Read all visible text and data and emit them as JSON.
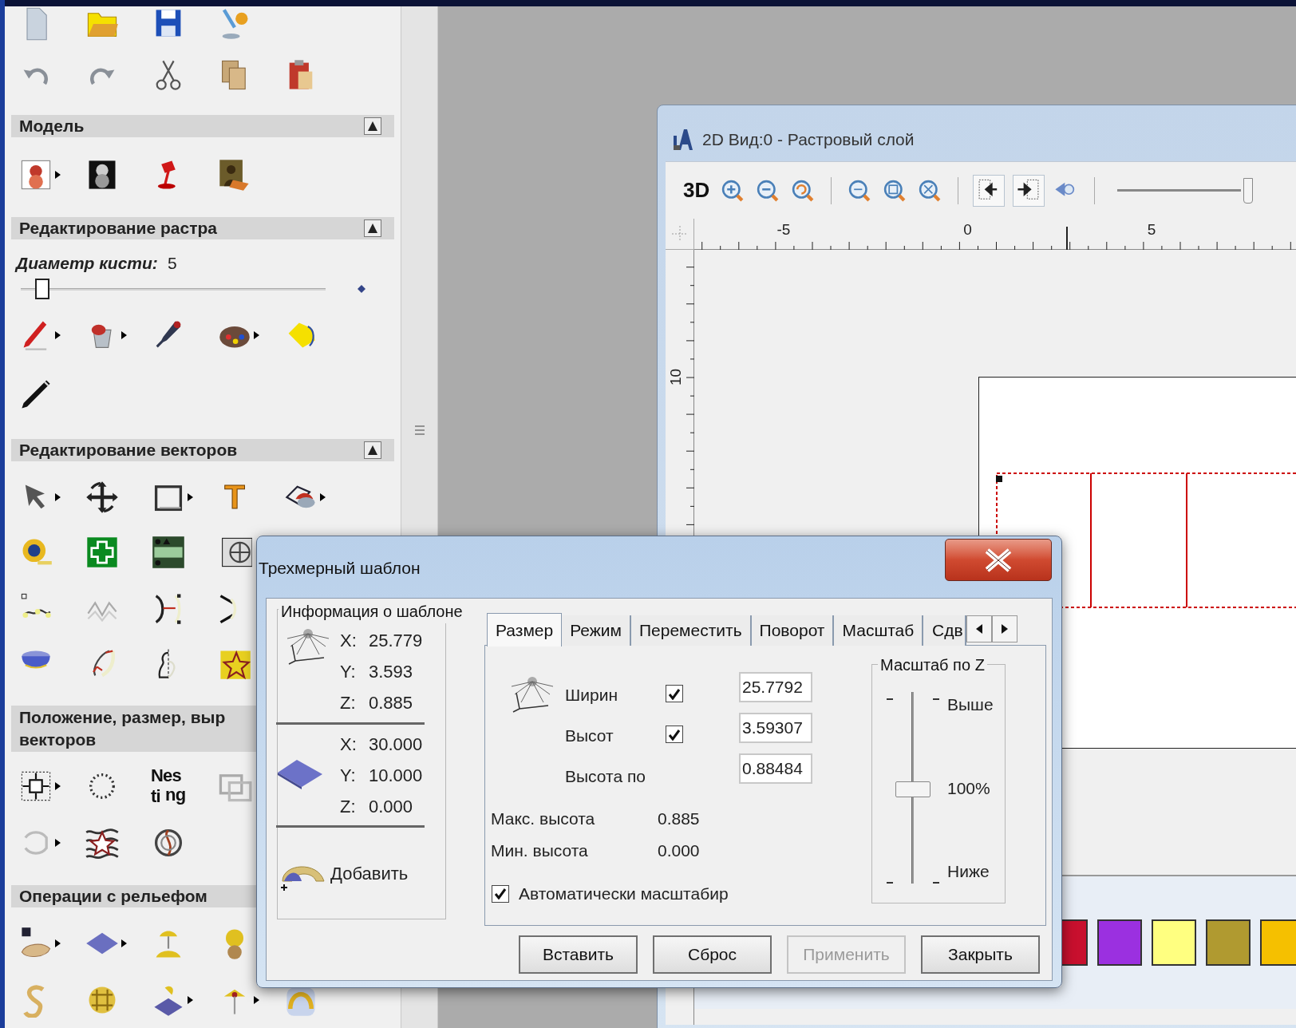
{
  "left_panel": {
    "sections": [
      {
        "title_lines": [
          "Модель"
        ]
      },
      {
        "title_lines": [
          "Редактирование растра"
        ]
      },
      {
        "title_lines": [
          "Редактирование векторов"
        ]
      },
      {
        "title_lines": [
          "Положение, размер, выр",
          "векторов"
        ]
      },
      {
        "title_lines": [
          "Операции с рельефом"
        ]
      }
    ],
    "brush_diameter": {
      "label": "Диаметр кисти:",
      "value": "5",
      "level": 0.05
    },
    "text_tool_glyph": "T",
    "nesting_glyphs": [
      "Nes",
      "ti",
      "ng"
    ]
  },
  "view_window": {
    "title": "2D Вид:0 - Растровый слой",
    "mode_button": "3D",
    "zoom_slider": {
      "level": 1
    },
    "ruler": {
      "x_labels": [
        "-5",
        "0",
        "5"
      ],
      "y_labels": [
        "10"
      ]
    },
    "palette": [
      {
        "color": "#c8102e"
      },
      {
        "color": "#9b30e0"
      },
      {
        "color": "#ffff80"
      },
      {
        "color": "#b09a30"
      },
      {
        "color": "#f5c000"
      }
    ]
  },
  "dialog": {
    "title": "Трехмерный шаблон",
    "info_group": {
      "legend": "Информация о шаблоне",
      "template_coords": [
        {
          "axis": "X:",
          "value": "25.779"
        },
        {
          "axis": "Y:",
          "value": "3.593"
        },
        {
          "axis": "Z:",
          "value": "0.885"
        }
      ],
      "plate_coords": [
        {
          "axis": "X:",
          "value": "30.000"
        },
        {
          "axis": "Y:",
          "value": "10.000"
        },
        {
          "axis": "Z:",
          "value": "0.000"
        }
      ],
      "add_button": "Добавить"
    },
    "tabs": [
      {
        "label": "Размер",
        "selected": true
      },
      {
        "label": "Режим",
        "selected": false
      },
      {
        "label": "Переместить",
        "selected": false
      },
      {
        "label": "Поворот",
        "selected": false
      },
      {
        "label": "Масштаб",
        "selected": false
      },
      {
        "label": "Сдв",
        "selected": false
      }
    ],
    "size_tab": {
      "rows": [
        {
          "label": "Ширин",
          "checked": true,
          "value": "25.7792"
        },
        {
          "label": "Высот",
          "checked": true,
          "value": "3.59307"
        },
        {
          "label": "Высота по",
          "value": "0.88484"
        }
      ],
      "stats": [
        {
          "label": "Макс. высота",
          "value": "0.885"
        },
        {
          "label": "Мин. высота",
          "value": "0.000"
        }
      ],
      "auto_scale": {
        "label": "Автоматически масштабир",
        "checked": true
      },
      "z_scale": {
        "legend": "Масштаб по Z",
        "top": "Выше",
        "middle": "100%",
        "bottom": "Ниже",
        "level": 0.5
      }
    },
    "buttons": [
      {
        "label": "Вставить",
        "disabled": false
      },
      {
        "label": "Сброс",
        "disabled": false
      },
      {
        "label": "Применить",
        "disabled": true
      },
      {
        "label": "Закрыть",
        "disabled": false
      }
    ]
  }
}
